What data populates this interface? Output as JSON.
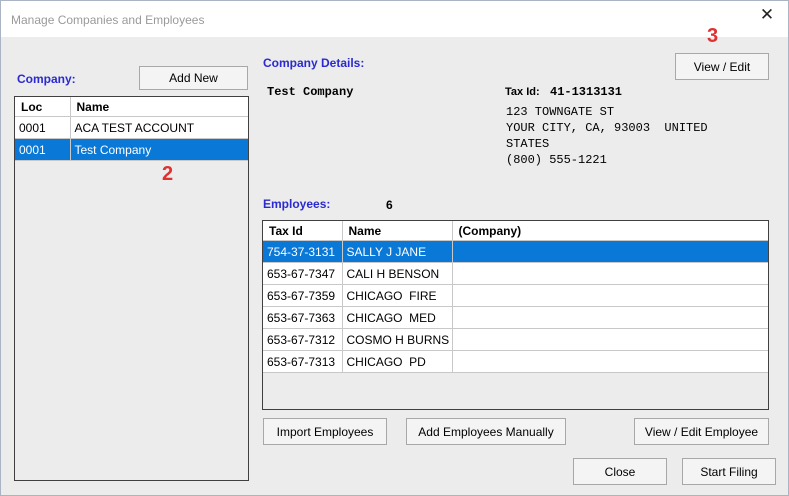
{
  "window": {
    "title": "Manage Companies and Employees",
    "close_glyph": "✕"
  },
  "company": {
    "label": "Company:",
    "add_new": "Add New",
    "columns": [
      "Loc",
      "Name"
    ],
    "rows": [
      {
        "loc": "0001",
        "name": "ACA TEST ACCOUNT"
      },
      {
        "loc": "0001",
        "name": "Test Company"
      }
    ],
    "selected_index": 1
  },
  "details": {
    "label": "Company Details:",
    "view_edit": "View / Edit",
    "name": "Test Company",
    "tax_id_label": "Tax Id:",
    "tax_id": "41-1313131",
    "address1": "123 TOWNGATE ST",
    "address2": "YOUR CITY, CA, 93003  UNITED",
    "address3": "STATES",
    "phone": "(800) 555-1221"
  },
  "employees": {
    "label": "Employees:",
    "count": "6",
    "columns": [
      "Tax Id",
      "Name",
      "(Company)"
    ],
    "rows": [
      {
        "tax_id": "754-37-3131",
        "name": "SALLY J JANE",
        "company": ""
      },
      {
        "tax_id": "653-67-7347",
        "name": "CALI H BENSON",
        "company": ""
      },
      {
        "tax_id": "653-67-7359",
        "name": "CHICAGO  FIRE",
        "company": ""
      },
      {
        "tax_id": "653-67-7363",
        "name": "CHICAGO  MED",
        "company": ""
      },
      {
        "tax_id": "653-67-7312",
        "name": "COSMO H BURNS",
        "company": ""
      },
      {
        "tax_id": "653-67-7313",
        "name": "CHICAGO  PD",
        "company": ""
      }
    ],
    "selected_index": 0
  },
  "buttons": {
    "import": "Import Employees",
    "add_manual": "Add Employees Manually",
    "view_edit_employee": "View / Edit Employee",
    "close": "Close",
    "start_filing": "Start Filing"
  },
  "annotations": [
    "2",
    "3"
  ],
  "colors": {
    "selection": "#0a78d7",
    "section_label": "#2a2ad0",
    "annotation": "#e03030"
  }
}
